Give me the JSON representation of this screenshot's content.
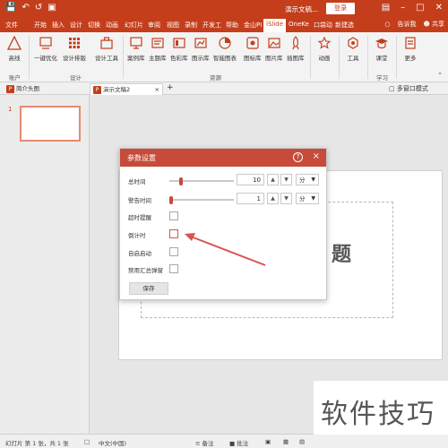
{
  "title_bar": {
    "doc_title": "演示文稿...",
    "login_label": "登录"
  },
  "tabs": [
    "文件",
    "开始",
    "插入",
    "设计",
    "切换",
    "动画",
    "幻灯片",
    "审阅",
    "视图",
    "录制",
    "开发工",
    "帮助",
    "金山PI",
    "iSlide",
    "OneKe",
    "口袋动",
    "新建选"
  ],
  "active_tab": "iSlide",
  "tab_tools": {
    "tell_me": "告诉我",
    "share": "共享"
  },
  "ribbon": {
    "buttons": {
      "account": "高线",
      "optimize": "一键优化",
      "design_layout": "设计排版",
      "design_tools": "设计工具",
      "case_lib": "案例库",
      "theme_lib": "主题库",
      "color_lib": "色彩库",
      "chart_lib": "图示库",
      "smart_chart": "智能图表",
      "icon_lib": "图标库",
      "image_lib": "图片库",
      "illus_lib": "插图库",
      "animation": "动画",
      "tools": "工具",
      "classroom": "课堂",
      "more": "更多"
    },
    "groups": {
      "account": "账户",
      "design": "设计",
      "resources": "资源",
      "learn": "学习"
    }
  },
  "doc_tabs": {
    "tab1": "简介头图",
    "tab2": "演示文稿2",
    "add": "+",
    "multi_window": "多窗口模式"
  },
  "slide_panel": {
    "slide_number": "1"
  },
  "slide": {
    "visible_title_fragment": "题"
  },
  "dialog": {
    "title": "参数设置",
    "help": "?",
    "close": "×",
    "total_time": {
      "label": "总时间",
      "value": "10",
      "unit": "分",
      "slider_fraction": 0.18
    },
    "warn_time": {
      "label": "警告时间",
      "value": "1",
      "unit": "分",
      "slider_fraction": 0.02
    },
    "checkboxes": {
      "overtime_alert": "超时提醒",
      "countdown": "倒计时",
      "autostart": "自启启动",
      "disable_popup": "禁用汇总弹窗"
    },
    "save_label": "保存"
  },
  "status": {
    "slide_info": "幻灯片 第 1 张，共 1 张",
    "language": "中文(中国)",
    "notes": "备注",
    "comments": "批注"
  },
  "watermark": "软件技巧",
  "colors": {
    "accent": "#c43e1c",
    "dialog_header": "#c74b3a",
    "arrow": "#d9534f"
  }
}
